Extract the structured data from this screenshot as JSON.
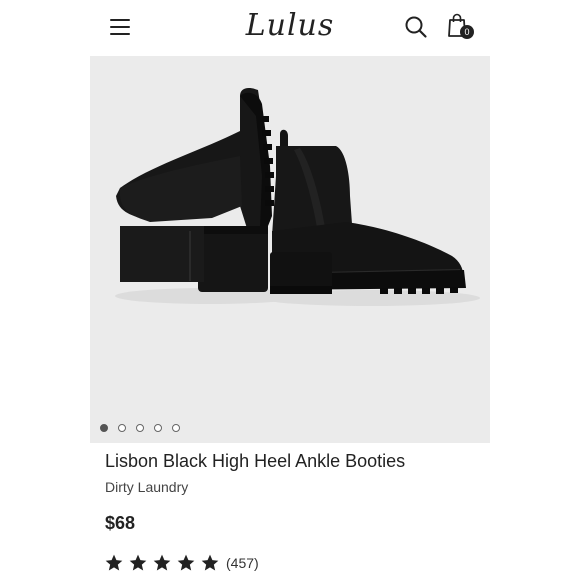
{
  "header": {
    "logo_text": "Lulus",
    "cart_count": "0",
    "icons": [
      "menu-icon",
      "search-icon",
      "shopping-bag-icon"
    ]
  },
  "gallery": {
    "image_count": 5,
    "active_index": 0,
    "photo_subject": "pair of black chelsea ankle booties with block heel"
  },
  "product": {
    "title": "Lisbon Black High Heel Ankle Booties",
    "brand": "Dirty Laundry",
    "price": "$68",
    "rating": 5,
    "review_count": "(457)"
  },
  "colors": {
    "page_background": "#ffffff",
    "gallery_background": "#ebebeb",
    "text": "#222222",
    "boot": "#141414"
  }
}
